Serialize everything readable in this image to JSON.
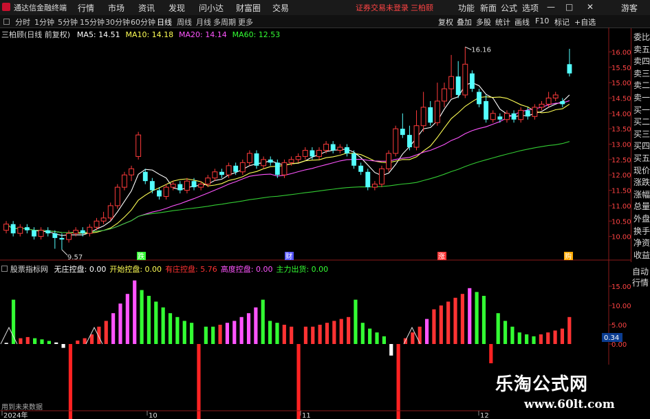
{
  "app": {
    "logo_text": "通达信金融终端",
    "menu": [
      "行情",
      "市场",
      "资讯",
      "发现",
      "问小达",
      "财富圈",
      "交易"
    ],
    "login_notice": "证券交易未登录",
    "user": "三柏颐",
    "right_menu": [
      "功能",
      "新面",
      "公式",
      "选项"
    ],
    "guest": "游客",
    "window_controls": [
      "—",
      "□",
      "✕"
    ]
  },
  "period_tabs": [
    "分时",
    "1分钟",
    "5分钟",
    "15分钟",
    "30分钟",
    "60分钟",
    "日线",
    "周线",
    "月线",
    "多周期",
    "更多"
  ],
  "active_tab": "日线",
  "tools": [
    "复权",
    "叠加",
    "多股",
    "统计",
    "画线",
    "F10",
    "标记",
    "+自选"
  ],
  "chart_header": {
    "title": "三柏顾(日线 前复权)",
    "ma5_label": "MA5: 14.51",
    "ma10_label": "MA10: 14.18",
    "ma20_label": "MA20: 14.14",
    "ma60_label": "MA60: 12.53"
  },
  "right_panel": [
    "委比",
    "卖五",
    "卖四",
    "卖三",
    "卖二",
    "卖一",
    "买一",
    "买二",
    "买三",
    "买四",
    "买五",
    "现价",
    "涨跌",
    "涨幅",
    "总量",
    "外盘",
    "换手",
    "净资",
    "收益"
  ],
  "lower_right": [
    "自动",
    "行情"
  ],
  "lower_header": {
    "name": "股票指标网",
    "items": [
      {
        "label": "无庄控盘: 0.00",
        "color": "#ffffff"
      },
      {
        "label": "开始控盘: 0.00",
        "color": "#ffff55"
      },
      {
        "label": "有庄控盘: 5.76",
        "color": "#ff3333"
      },
      {
        "label": "高度控盘: 0.00",
        "color": "#ff55ff"
      },
      {
        "label": "主力出货: 0.00",
        "color": "#33ff33"
      }
    ]
  },
  "event_marks": [
    "跌",
    "财",
    "涨",
    "购"
  ],
  "bottom_status": "用到未来数据",
  "date_axis": [
    "2024年",
    "10",
    "11",
    "12"
  ],
  "watermark": {
    "line1": "乐淘公式网",
    "line2": "www.60lt.com"
  },
  "chart_data": [
    {
      "type": "candlestick",
      "y_ticks": [
        10.0,
        10.5,
        11.0,
        11.5,
        12.0,
        12.5,
        13.0,
        13.5,
        14.0,
        14.5,
        15.0,
        15.5,
        16.0
      ],
      "ylim": [
        9.5,
        16.3
      ],
      "annotations": [
        {
          "text": "16.16",
          "value": 16.16
        },
        {
          "text": "9.57",
          "value": 9.57
        }
      ],
      "candles": [
        [
          10.2,
          10.4,
          10.1,
          10.5
        ],
        [
          10.4,
          10.1,
          10.0,
          10.5
        ],
        [
          10.1,
          10.3,
          10.0,
          10.4
        ],
        [
          10.3,
          10.2,
          10.1,
          10.4
        ],
        [
          10.2,
          10.0,
          9.9,
          10.3
        ],
        [
          10.0,
          10.2,
          9.9,
          10.3
        ],
        [
          10.2,
          10.1,
          10.0,
          10.3
        ],
        [
          10.1,
          9.95,
          9.6,
          10.2
        ],
        [
          9.95,
          9.9,
          9.57,
          10.1
        ],
        [
          9.9,
          10.1,
          9.8,
          10.2
        ],
        [
          10.1,
          10.2,
          10.0,
          10.3
        ],
        [
          10.2,
          10.1,
          10.0,
          10.3
        ],
        [
          10.1,
          10.3,
          10.0,
          10.4
        ],
        [
          10.3,
          10.5,
          10.2,
          10.6
        ],
        [
          10.5,
          10.6,
          10.4,
          10.8
        ],
        [
          10.6,
          11.0,
          10.5,
          11.1
        ],
        [
          11.0,
          11.6,
          10.9,
          11.7
        ],
        [
          11.6,
          12.0,
          11.5,
          12.1
        ],
        [
          12.0,
          12.2,
          11.8,
          12.3
        ],
        [
          12.6,
          13.3,
          12.5,
          13.4
        ],
        [
          12.1,
          11.8,
          11.7,
          12.2
        ],
        [
          11.8,
          11.5,
          11.4,
          11.9
        ],
        [
          11.5,
          11.3,
          11.2,
          11.6
        ],
        [
          11.3,
          11.6,
          11.2,
          11.7
        ],
        [
          11.6,
          11.7,
          11.5,
          11.8
        ],
        [
          11.7,
          11.5,
          11.4,
          11.8
        ],
        [
          11.5,
          11.8,
          11.4,
          11.9
        ],
        [
          11.8,
          11.6,
          11.5,
          11.9
        ],
        [
          11.6,
          11.7,
          11.5,
          11.8
        ],
        [
          11.7,
          11.9,
          11.6,
          12.0
        ],
        [
          11.9,
          12.1,
          11.8,
          12.2
        ],
        [
          12.1,
          12.0,
          11.9,
          12.2
        ],
        [
          12.0,
          12.3,
          11.9,
          12.4
        ],
        [
          12.3,
          12.1,
          12.0,
          12.4
        ],
        [
          12.1,
          12.4,
          12.0,
          12.5
        ],
        [
          12.4,
          12.7,
          12.3,
          12.8
        ],
        [
          12.7,
          12.3,
          12.2,
          12.8
        ],
        [
          12.3,
          12.5,
          12.2,
          12.6
        ],
        [
          12.5,
          12.4,
          12.3,
          12.6
        ],
        [
          12.4,
          12.0,
          11.9,
          12.5
        ],
        [
          12.0,
          12.4,
          11.9,
          12.5
        ],
        [
          12.4,
          12.5,
          12.3,
          12.6
        ],
        [
          12.5,
          12.6,
          12.4,
          12.7
        ],
        [
          12.6,
          12.8,
          12.5,
          12.9
        ],
        [
          12.8,
          12.6,
          12.5,
          12.9
        ],
        [
          12.6,
          12.8,
          12.5,
          12.9
        ],
        [
          12.8,
          13.0,
          12.7,
          13.1
        ],
        [
          13.0,
          12.8,
          12.7,
          13.1
        ],
        [
          12.8,
          12.9,
          12.7,
          13.0
        ],
        [
          12.9,
          12.7,
          12.6,
          13.0
        ],
        [
          12.7,
          12.3,
          12.2,
          12.8
        ],
        [
          12.3,
          12.1,
          12.0,
          12.4
        ],
        [
          12.1,
          11.6,
          11.5,
          12.2
        ],
        [
          11.6,
          11.7,
          11.5,
          11.8
        ],
        [
          11.7,
          12.2,
          11.6,
          12.3
        ],
        [
          12.2,
          12.7,
          12.1,
          12.8
        ],
        [
          12.7,
          13.5,
          12.6,
          13.6
        ],
        [
          13.5,
          13.3,
          13.2,
          14.0
        ],
        [
          13.3,
          12.9,
          12.8,
          13.6
        ],
        [
          12.9,
          13.6,
          12.8,
          14.1
        ],
        [
          13.6,
          14.2,
          13.4,
          14.7
        ],
        [
          14.2,
          13.7,
          13.6,
          14.4
        ],
        [
          13.7,
          14.4,
          13.6,
          15.0
        ],
        [
          14.4,
          14.8,
          14.2,
          15.0
        ],
        [
          14.8,
          15.2,
          14.5,
          15.9
        ],
        [
          15.2,
          14.6,
          14.5,
          15.7
        ],
        [
          14.6,
          15.6,
          14.5,
          16.16
        ],
        [
          15.3,
          14.8,
          14.7,
          15.4
        ],
        [
          14.7,
          14.3,
          14.2,
          14.8
        ],
        [
          14.4,
          13.8,
          13.7,
          14.6
        ],
        [
          13.8,
          14.0,
          13.7,
          14.1
        ],
        [
          13.9,
          13.8,
          13.7,
          14.0
        ],
        [
          13.8,
          14.0,
          13.7,
          14.1
        ],
        [
          14.0,
          13.8,
          13.7,
          14.1
        ],
        [
          13.8,
          14.1,
          13.7,
          14.2
        ],
        [
          14.1,
          13.9,
          13.8,
          14.2
        ],
        [
          13.9,
          14.2,
          13.8,
          14.3
        ],
        [
          14.2,
          14.3,
          14.1,
          14.4
        ],
        [
          14.3,
          14.5,
          14.2,
          14.7
        ],
        [
          14.5,
          14.6,
          14.4,
          14.7
        ],
        [
          14.4,
          14.3,
          14.2,
          14.5
        ],
        [
          15.6,
          15.3,
          15.2,
          16.1
        ]
      ],
      "ma_series": [
        {
          "name": "MA5",
          "color": "#ffffff"
        },
        {
          "name": "MA10",
          "color": "#ffff55"
        },
        {
          "name": "MA20",
          "color": "#ff55ff"
        },
        {
          "name": "MA60",
          "color": "#33cc33"
        }
      ]
    },
    {
      "type": "bar",
      "y_ticks": [
        0.0,
        5.0,
        10.0,
        15.0
      ],
      "ylim": [
        -20,
        20
      ],
      "values": [
        {
          "v": 0.3,
          "c": "#ffffff"
        },
        {
          "v": 11.5,
          "c": "#33ff33"
        },
        {
          "v": 1.5,
          "c": "#ff3333"
        },
        {
          "v": 1.8,
          "c": "#ff3333"
        },
        {
          "v": 1.5,
          "c": "#33ff33"
        },
        {
          "v": 1.2,
          "c": "#33ff33"
        },
        {
          "v": 0.8,
          "c": "#33ff33"
        },
        {
          "v": 0.4,
          "c": "#ffffff"
        },
        {
          "v": -1.0,
          "c": "#ffffff"
        },
        {
          "v": -20,
          "c": "#ff2222"
        },
        {
          "v": 0.9,
          "c": "#ff3333"
        },
        {
          "v": 1.5,
          "c": "#ff3333"
        },
        {
          "v": 2.5,
          "c": "#ff3333"
        },
        {
          "v": 4.5,
          "c": "#ff3333"
        },
        {
          "v": 6.0,
          "c": "#ff3333"
        },
        {
          "v": 8.0,
          "c": "#ff55ff"
        },
        {
          "v": 10.5,
          "c": "#ff55ff"
        },
        {
          "v": 13.0,
          "c": "#ff55ff"
        },
        {
          "v": 16.5,
          "c": "#ff55ff"
        },
        {
          "v": 14.0,
          "c": "#33ff33"
        },
        {
          "v": 12.5,
          "c": "#33ff33"
        },
        {
          "v": 11.0,
          "c": "#33ff33"
        },
        {
          "v": 9.5,
          "c": "#33ff33"
        },
        {
          "v": 8.0,
          "c": "#33ff33"
        },
        {
          "v": 7.0,
          "c": "#33ff33"
        },
        {
          "v": 6.0,
          "c": "#33ff33"
        },
        {
          "v": 5.5,
          "c": "#33ff33"
        },
        {
          "v": -20,
          "c": "#ff2222"
        },
        {
          "v": 4.5,
          "c": "#33ff33"
        },
        {
          "v": 4.5,
          "c": "#33ff33"
        },
        {
          "v": 5.0,
          "c": "#ff3333"
        },
        {
          "v": 5.5,
          "c": "#ff55ff"
        },
        {
          "v": 6.0,
          "c": "#ff55ff"
        },
        {
          "v": 7.0,
          "c": "#ff55ff"
        },
        {
          "v": 8.0,
          "c": "#ff55ff"
        },
        {
          "v": 9.5,
          "c": "#ff55ff"
        },
        {
          "v": 11.5,
          "c": "#33ff33"
        },
        {
          "v": 6.0,
          "c": "#33ff33"
        },
        {
          "v": 5.5,
          "c": "#33ff33"
        },
        {
          "v": 5.0,
          "c": "#ff3333"
        },
        {
          "v": 4.5,
          "c": "#ff3333"
        },
        {
          "v": -20,
          "c": "#ff2222"
        },
        {
          "v": 4.5,
          "c": "#ff3333"
        },
        {
          "v": 4.5,
          "c": "#ff3333"
        },
        {
          "v": 5.0,
          "c": "#ff3333"
        },
        {
          "v": 5.5,
          "c": "#ff3333"
        },
        {
          "v": 6.0,
          "c": "#ff3333"
        },
        {
          "v": 6.5,
          "c": "#ff3333"
        },
        {
          "v": 7.0,
          "c": "#ff3333"
        },
        {
          "v": 11.5,
          "c": "#33ff33"
        },
        {
          "v": 5.5,
          "c": "#33ff33"
        },
        {
          "v": 4.0,
          "c": "#33ff33"
        },
        {
          "v": 3.0,
          "c": "#33ff33"
        },
        {
          "v": 2.0,
          "c": "#33ff33"
        },
        {
          "v": -3.0,
          "c": "#ffffff"
        },
        {
          "v": -20,
          "c": "#ff2222"
        },
        {
          "v": 1.5,
          "c": "#ff3333"
        },
        {
          "v": 3.0,
          "c": "#ff3333"
        },
        {
          "v": 4.5,
          "c": "#ff3333"
        },
        {
          "v": 6.5,
          "c": "#ff55ff"
        },
        {
          "v": 9.0,
          "c": "#ff3333"
        },
        {
          "v": 10.0,
          "c": "#ff3333"
        },
        {
          "v": 11.0,
          "c": "#ff3333"
        },
        {
          "v": 12.0,
          "c": "#ff3333"
        },
        {
          "v": 13.0,
          "c": "#ff3333"
        },
        {
          "v": 14.5,
          "c": "#ff55ff"
        },
        {
          "v": 13.5,
          "c": "#33ff33"
        },
        {
          "v": 12.5,
          "c": "#33ff33"
        },
        {
          "v": -5.0,
          "c": "#ff2222"
        },
        {
          "v": 8.0,
          "c": "#33ff33"
        },
        {
          "v": 6.0,
          "c": "#33ff33"
        },
        {
          "v": 4.5,
          "c": "#33ff33"
        },
        {
          "v": 3.0,
          "c": "#33ff33"
        },
        {
          "v": 2.5,
          "c": "#33ff33"
        },
        {
          "v": 2.0,
          "c": "#33ff33"
        },
        {
          "v": 2.5,
          "c": "#ff3333"
        },
        {
          "v": 3.0,
          "c": "#ff3333"
        },
        {
          "v": 3.5,
          "c": "#ff3333"
        },
        {
          "v": 4.0,
          "c": "#ff3333"
        },
        {
          "v": 7.0,
          "c": "#ff3333"
        }
      ],
      "current_value_label": "0.34"
    }
  ]
}
